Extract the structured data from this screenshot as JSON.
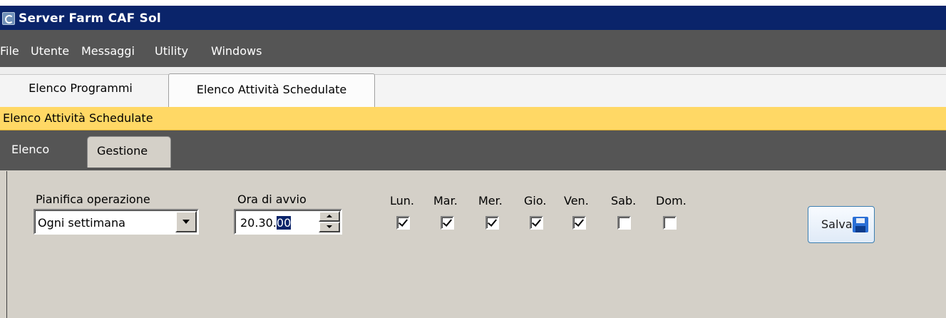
{
  "window": {
    "title": "Server Farm CAF Sol",
    "icon": "app-icon"
  },
  "menu": [
    "File",
    "Utente",
    "Messaggi",
    "Utility",
    "Windows"
  ],
  "program_tabs": [
    {
      "label": "Elenco Programmi",
      "active": false
    },
    {
      "label": "Elenco Attività Schedulate",
      "active": true
    }
  ],
  "section_title": "Elenco Attività Schedulate",
  "sub_tabs": [
    {
      "label": "Elenco",
      "active": false
    },
    {
      "label": "Gestione",
      "active": true
    }
  ],
  "form": {
    "schedule_label": "Pianifica operazione",
    "schedule_value": "Ogni settimana",
    "time_label": "Ora di avvio",
    "time_prefix": "20.30.",
    "time_selected": "00",
    "days": [
      {
        "label": "Lun.",
        "checked": true
      },
      {
        "label": "Mar.",
        "checked": true
      },
      {
        "label": "Mer.",
        "checked": true
      },
      {
        "label": "Gio.",
        "checked": true
      },
      {
        "label": "Ven.",
        "checked": true
      },
      {
        "label": "Sab.",
        "checked": false
      },
      {
        "label": "Dom.",
        "checked": false
      }
    ],
    "save_label": "Salva",
    "save_icon": "floppy-disk-icon"
  },
  "colors": {
    "titlebar": "#0a246a",
    "menubar": "#555555",
    "section_bar": "#ffd865",
    "panel": "#d4d0c8"
  }
}
